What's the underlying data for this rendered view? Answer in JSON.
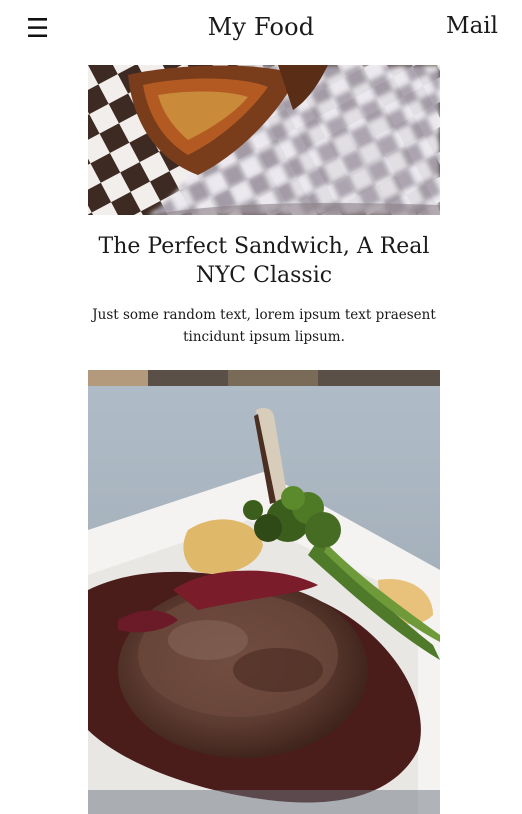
{
  "header": {
    "menu_icon": "hamburger-icon",
    "menu_glyph": "☰",
    "brand": "My Food",
    "mail_label": "Mail"
  },
  "cards": [
    {
      "image": "sandwich-photo",
      "title": "The Perfect Sandwich, A Real NYC Classic",
      "text": "Just some random text, lorem ipsum text praesent tincidunt ipsum lipsum."
    },
    {
      "image": "steak-photo"
    }
  ],
  "colors": {
    "text": "#1a1a1a",
    "background": "#ffffff"
  }
}
